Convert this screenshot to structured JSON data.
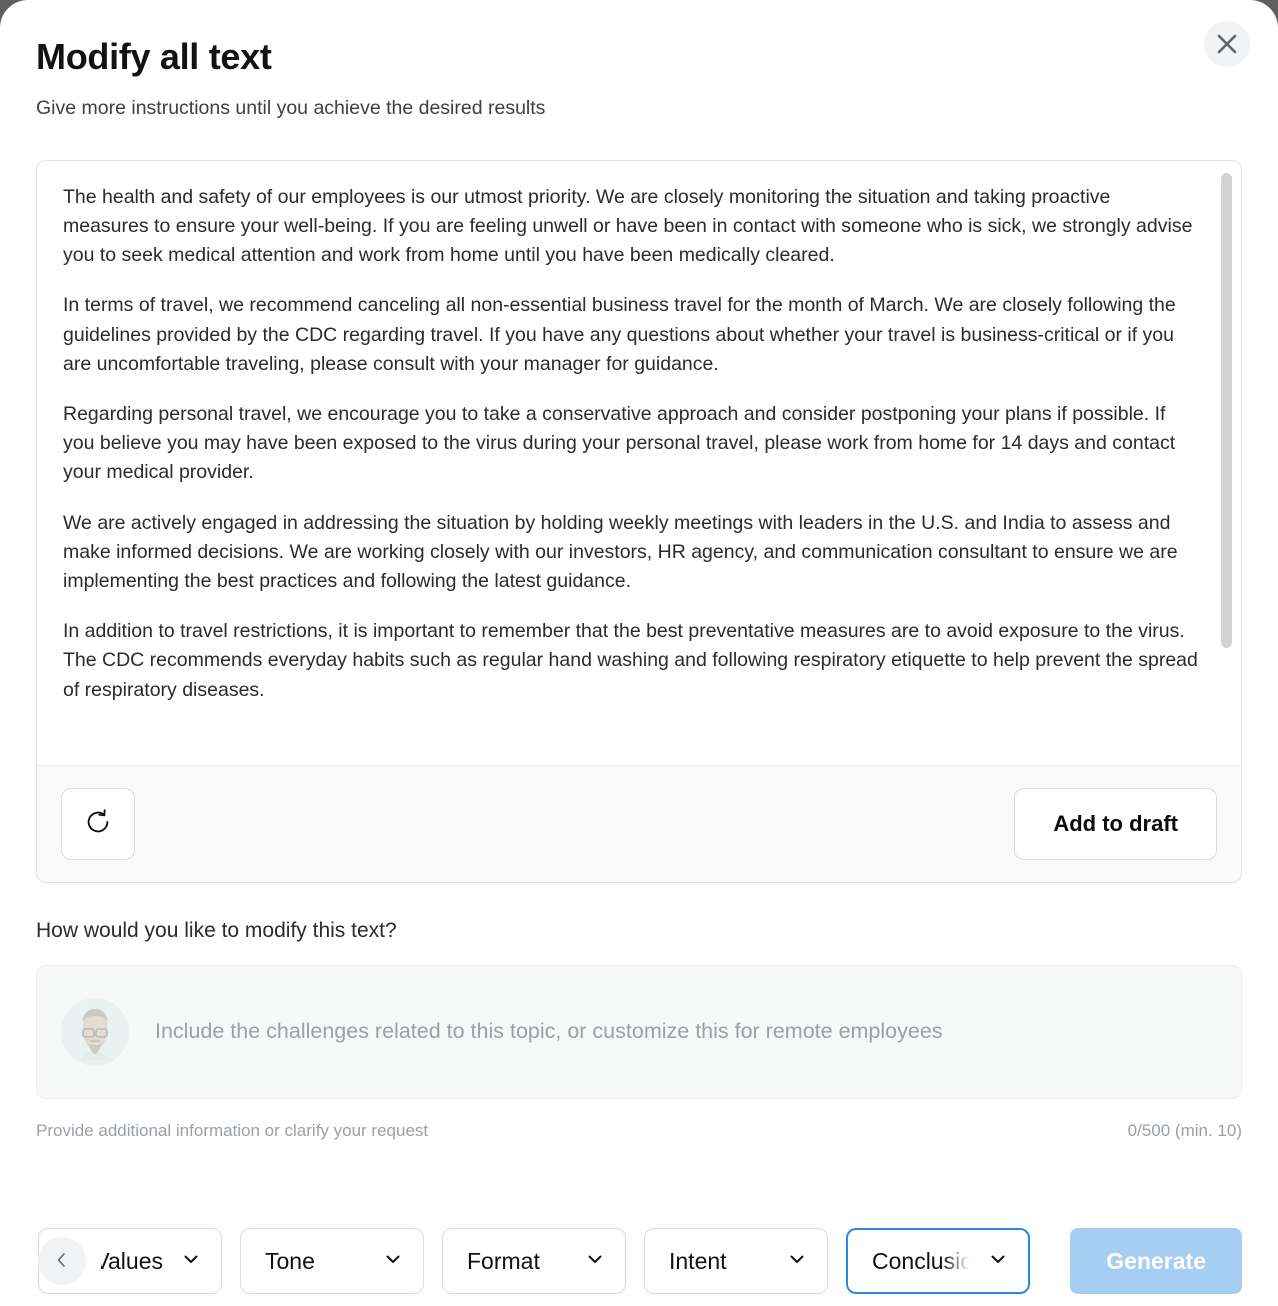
{
  "dialog": {
    "title": "Modify all text",
    "subtitle": "Give more instructions until you achieve the desired results",
    "close_label": "Close"
  },
  "result": {
    "paragraphs": [
      "The health and safety of our employees is our utmost priority. We are closely monitoring the situation and taking proactive measures to ensure your well-being. If you are feeling unwell or have been in contact with someone who is sick, we strongly advise you to seek medical attention and work from home until you have been medically cleared.",
      "In terms of travel, we recommend canceling all non-essential business travel for the month of March. We are closely following the guidelines provided by the CDC regarding travel. If you have any questions about whether your travel is business-critical or if you are uncomfortable traveling, please consult with your manager for guidance.",
      "Regarding personal travel, we encourage you to take a conservative approach and consider postponing your plans if possible. If you believe you may have been exposed to the virus during your personal travel, please work from home for 14 days and contact your medical provider.",
      "We are actively engaged in addressing the situation by holding weekly meetings with leaders in the U.S. and India to assess and make informed decisions. We are working closely with our investors, HR agency, and communication consultant to ensure we are implementing the best practices and following the latest guidance.",
      "In addition to travel restrictions, it is important to remember that the best preventative measures are to avoid exposure to the virus. The CDC recommends everyday habits such as regular hand washing and following respiratory etiquette to help prevent the spread of respiratory diseases."
    ],
    "regenerate_label": "Regenerate",
    "add_to_draft_label": "Add to draft"
  },
  "prompt": {
    "label": "How would you like to modify this text?",
    "placeholder": "Include the challenges related to this topic, or customize this for remote employees",
    "value": "",
    "helper_text": "Provide additional information or clarify your request",
    "counter_text": "0/500 (min. 10)"
  },
  "toolbar": {
    "scroll_left_label": "‹",
    "chips": [
      {
        "label": "Values",
        "active": false
      },
      {
        "label": "Tone",
        "active": false
      },
      {
        "label": "Format",
        "active": false
      },
      {
        "label": "Intent",
        "active": false
      },
      {
        "label": "Conclusion",
        "active": true
      }
    ],
    "generate_label": "Generate"
  },
  "colors": {
    "accent_blue": "#2e85e8",
    "generate_bg": "#a6cdf2",
    "border": "#dadce0",
    "muted_text": "#9aa0a6"
  }
}
